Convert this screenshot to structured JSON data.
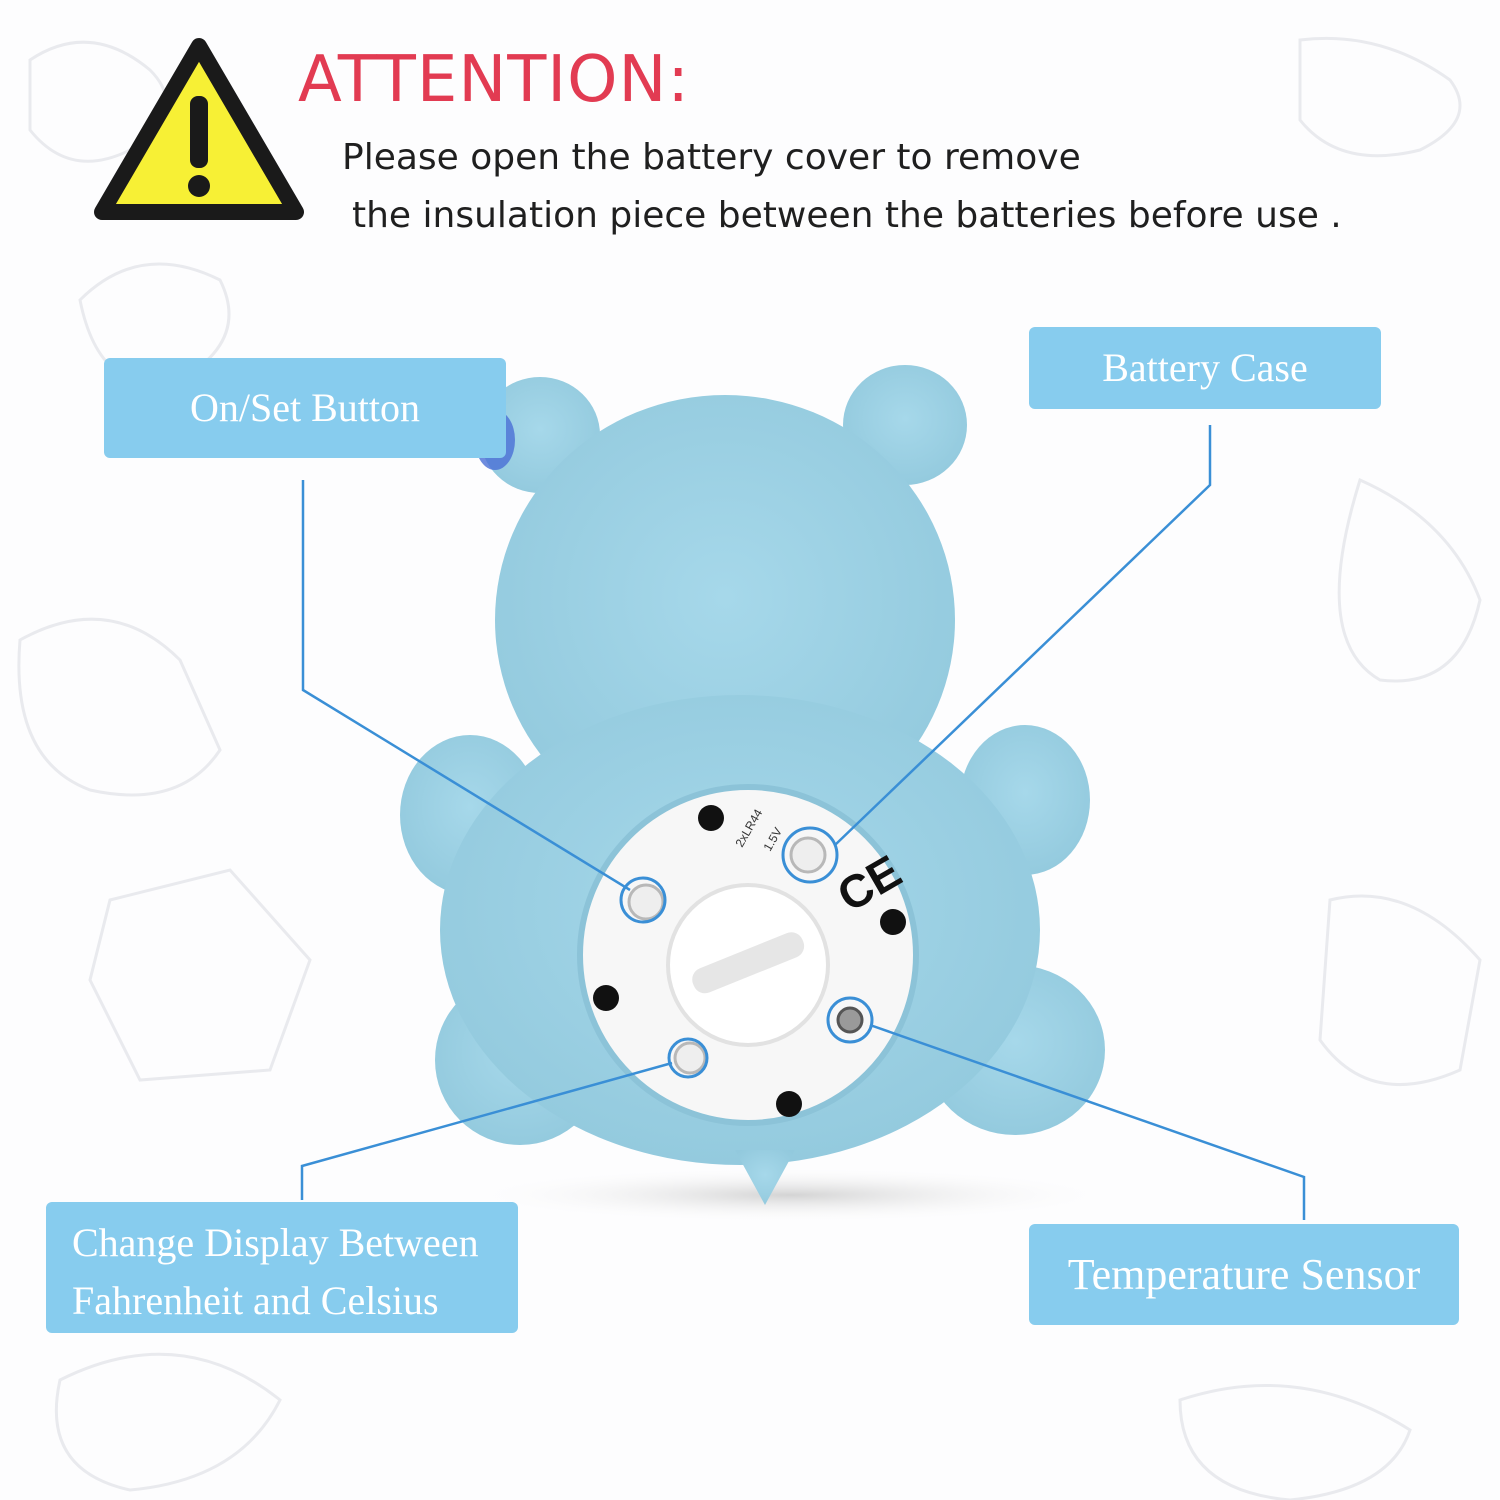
{
  "attention": {
    "title": "ATTENTION:",
    "line1": "Please open the battery cover to remove",
    "line2": "the insulation piece between the batteries before use ."
  },
  "labels": {
    "on_set_button": "On/Set Button",
    "battery_case": "Battery Case",
    "change_display_line1": "Change Display Between",
    "change_display_line2": "Fahrenheit and Celsius",
    "temperature_sensor": "Temperature Sensor"
  },
  "device_markings": {
    "battery_spec": "2xLR44",
    "voltage": "1.5V",
    "ce_mark": "CE"
  },
  "colors": {
    "label_bg": "#87ccee",
    "title_red": "#e23b52",
    "warning_yellow": "#f7f035",
    "device_blue": "#9fd4e6",
    "leader_line": "#3a8fd6"
  }
}
